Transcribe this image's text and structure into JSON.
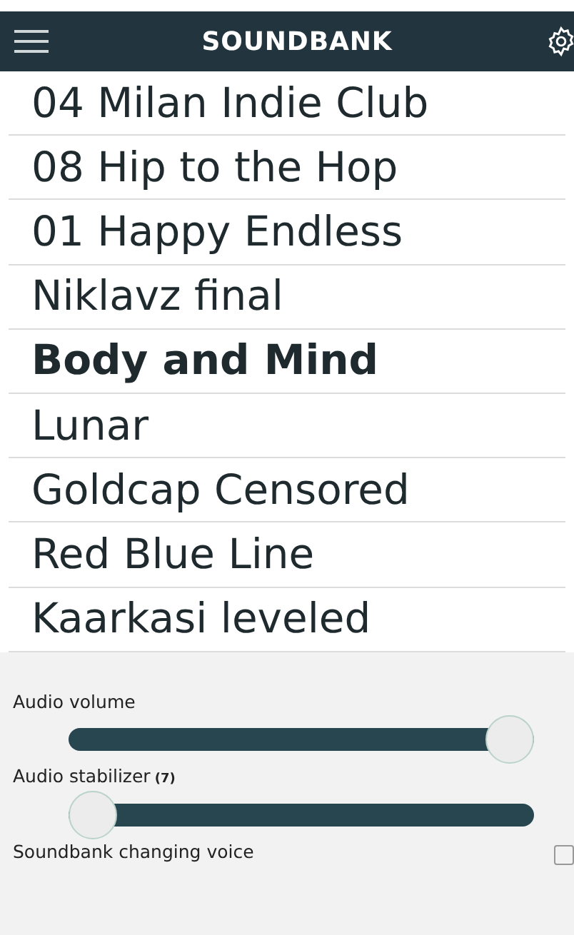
{
  "header": {
    "title": "SOUNDBANK"
  },
  "tracks": [
    {
      "title": "04 Milan Indie Club",
      "selected": false
    },
    {
      "title": "08 Hip to the Hop",
      "selected": false
    },
    {
      "title": "01 Happy Endless",
      "selected": false
    },
    {
      "title": "Niklavz final",
      "selected": false
    },
    {
      "title": "Body and Mind",
      "selected": true
    },
    {
      "title": "Lunar",
      "selected": false
    },
    {
      "title": "Goldcap Censored",
      "selected": false
    },
    {
      "title": "Red Blue Line",
      "selected": false
    },
    {
      "title": "Kaarkasi leveled",
      "selected": false
    }
  ],
  "settings": [
    {
      "kind": "slider",
      "label": "Audio volume",
      "level": 1
    },
    {
      "kind": "slider",
      "label": "Audio stabilizer",
      "note": "(7)",
      "level": 0
    },
    {
      "kind": "checkbox",
      "label": "Soundbank changing voice",
      "checked": false
    }
  ]
}
